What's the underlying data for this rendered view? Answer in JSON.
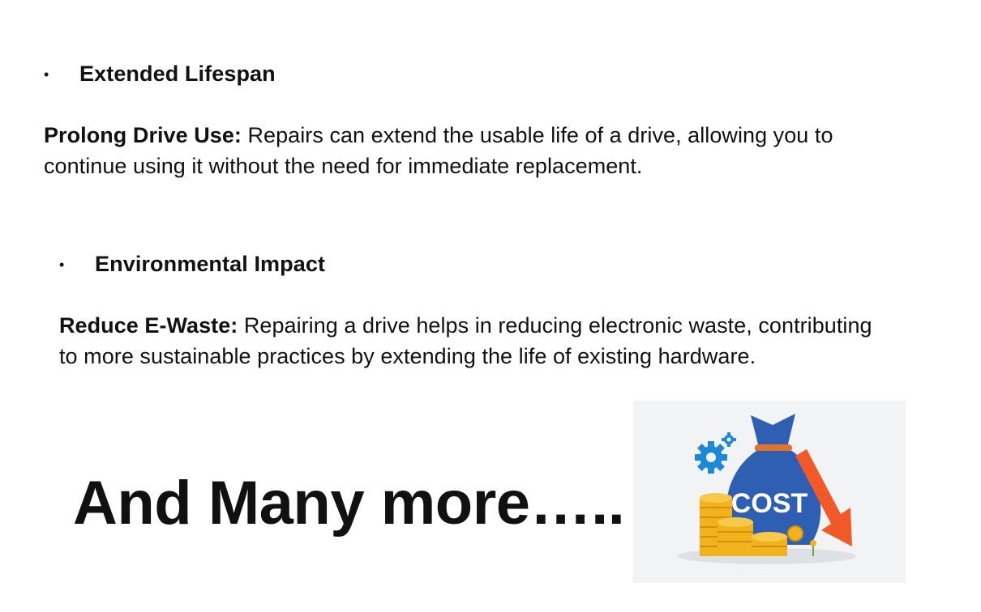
{
  "section1": {
    "bullet": "•",
    "heading": "Extended Lifespan",
    "term": "Prolong Drive Use:",
    "text_line1": " Repairs can extend the usable life of a drive, allowing you to",
    "text_line2": "continue using it without the need for immediate replacement."
  },
  "section2": {
    "bullet": "•",
    "heading": "Environmental Impact",
    "term": "Reduce E-Waste:",
    "text_line1": " Repairing a drive helps in reducing electronic waste, contributing",
    "text_line2": "to more sustainable practices by extending the life of existing hardware."
  },
  "footer": {
    "big_text": "And Many more….."
  },
  "illustration": {
    "icon": "cost-reduction-icon",
    "bag_label": "COST",
    "colors": {
      "bag": "#2f5fb3",
      "coins": "#f2b21b",
      "arrow": "#f05a28",
      "gear": "#1e88d8"
    }
  }
}
